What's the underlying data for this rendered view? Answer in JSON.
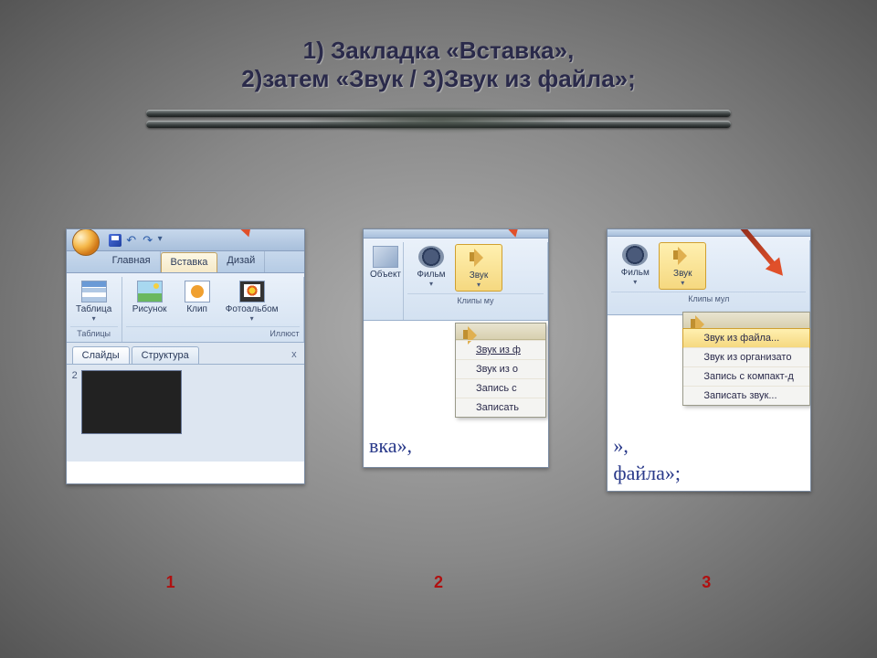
{
  "title": {
    "line1": "1) Закладка «Вставка»,",
    "line2": "2)затем  «Звук / 3)Звук из файла»;"
  },
  "step_labels": [
    "1",
    "2",
    "3"
  ],
  "shot1": {
    "tabs": [
      "Главная",
      "Вставка",
      "Дизай"
    ],
    "active_tab_index": 1,
    "groups": {
      "tables": {
        "label": "Таблицы",
        "button": "Таблица"
      },
      "illustrations": {
        "label": "Иллюст",
        "buttons": [
          "Рисунок",
          "Клип",
          "Фотоальбом"
        ]
      }
    },
    "slide_tabs": {
      "slides": "Слайды",
      "outline": "Структура"
    },
    "slide_num": "2"
  },
  "shot2": {
    "buttons": {
      "object": "Объект",
      "movie": "Фильм",
      "sound": "Звук"
    },
    "group_label": "Клипы му",
    "menu": [
      "Звук из ф",
      "Звук из о",
      "Запись с",
      "Записать"
    ],
    "fragment": "вка»,"
  },
  "shot3": {
    "buttons": {
      "movie": "Фильм",
      "sound": "Звук"
    },
    "group_label": "Клипы мул",
    "menu": [
      "Звук из файла...",
      "Звук из организато",
      "Запись с компакт-д",
      "Записать звук..."
    ],
    "fragment_a": "»,",
    "fragment_b": "файла»;"
  }
}
